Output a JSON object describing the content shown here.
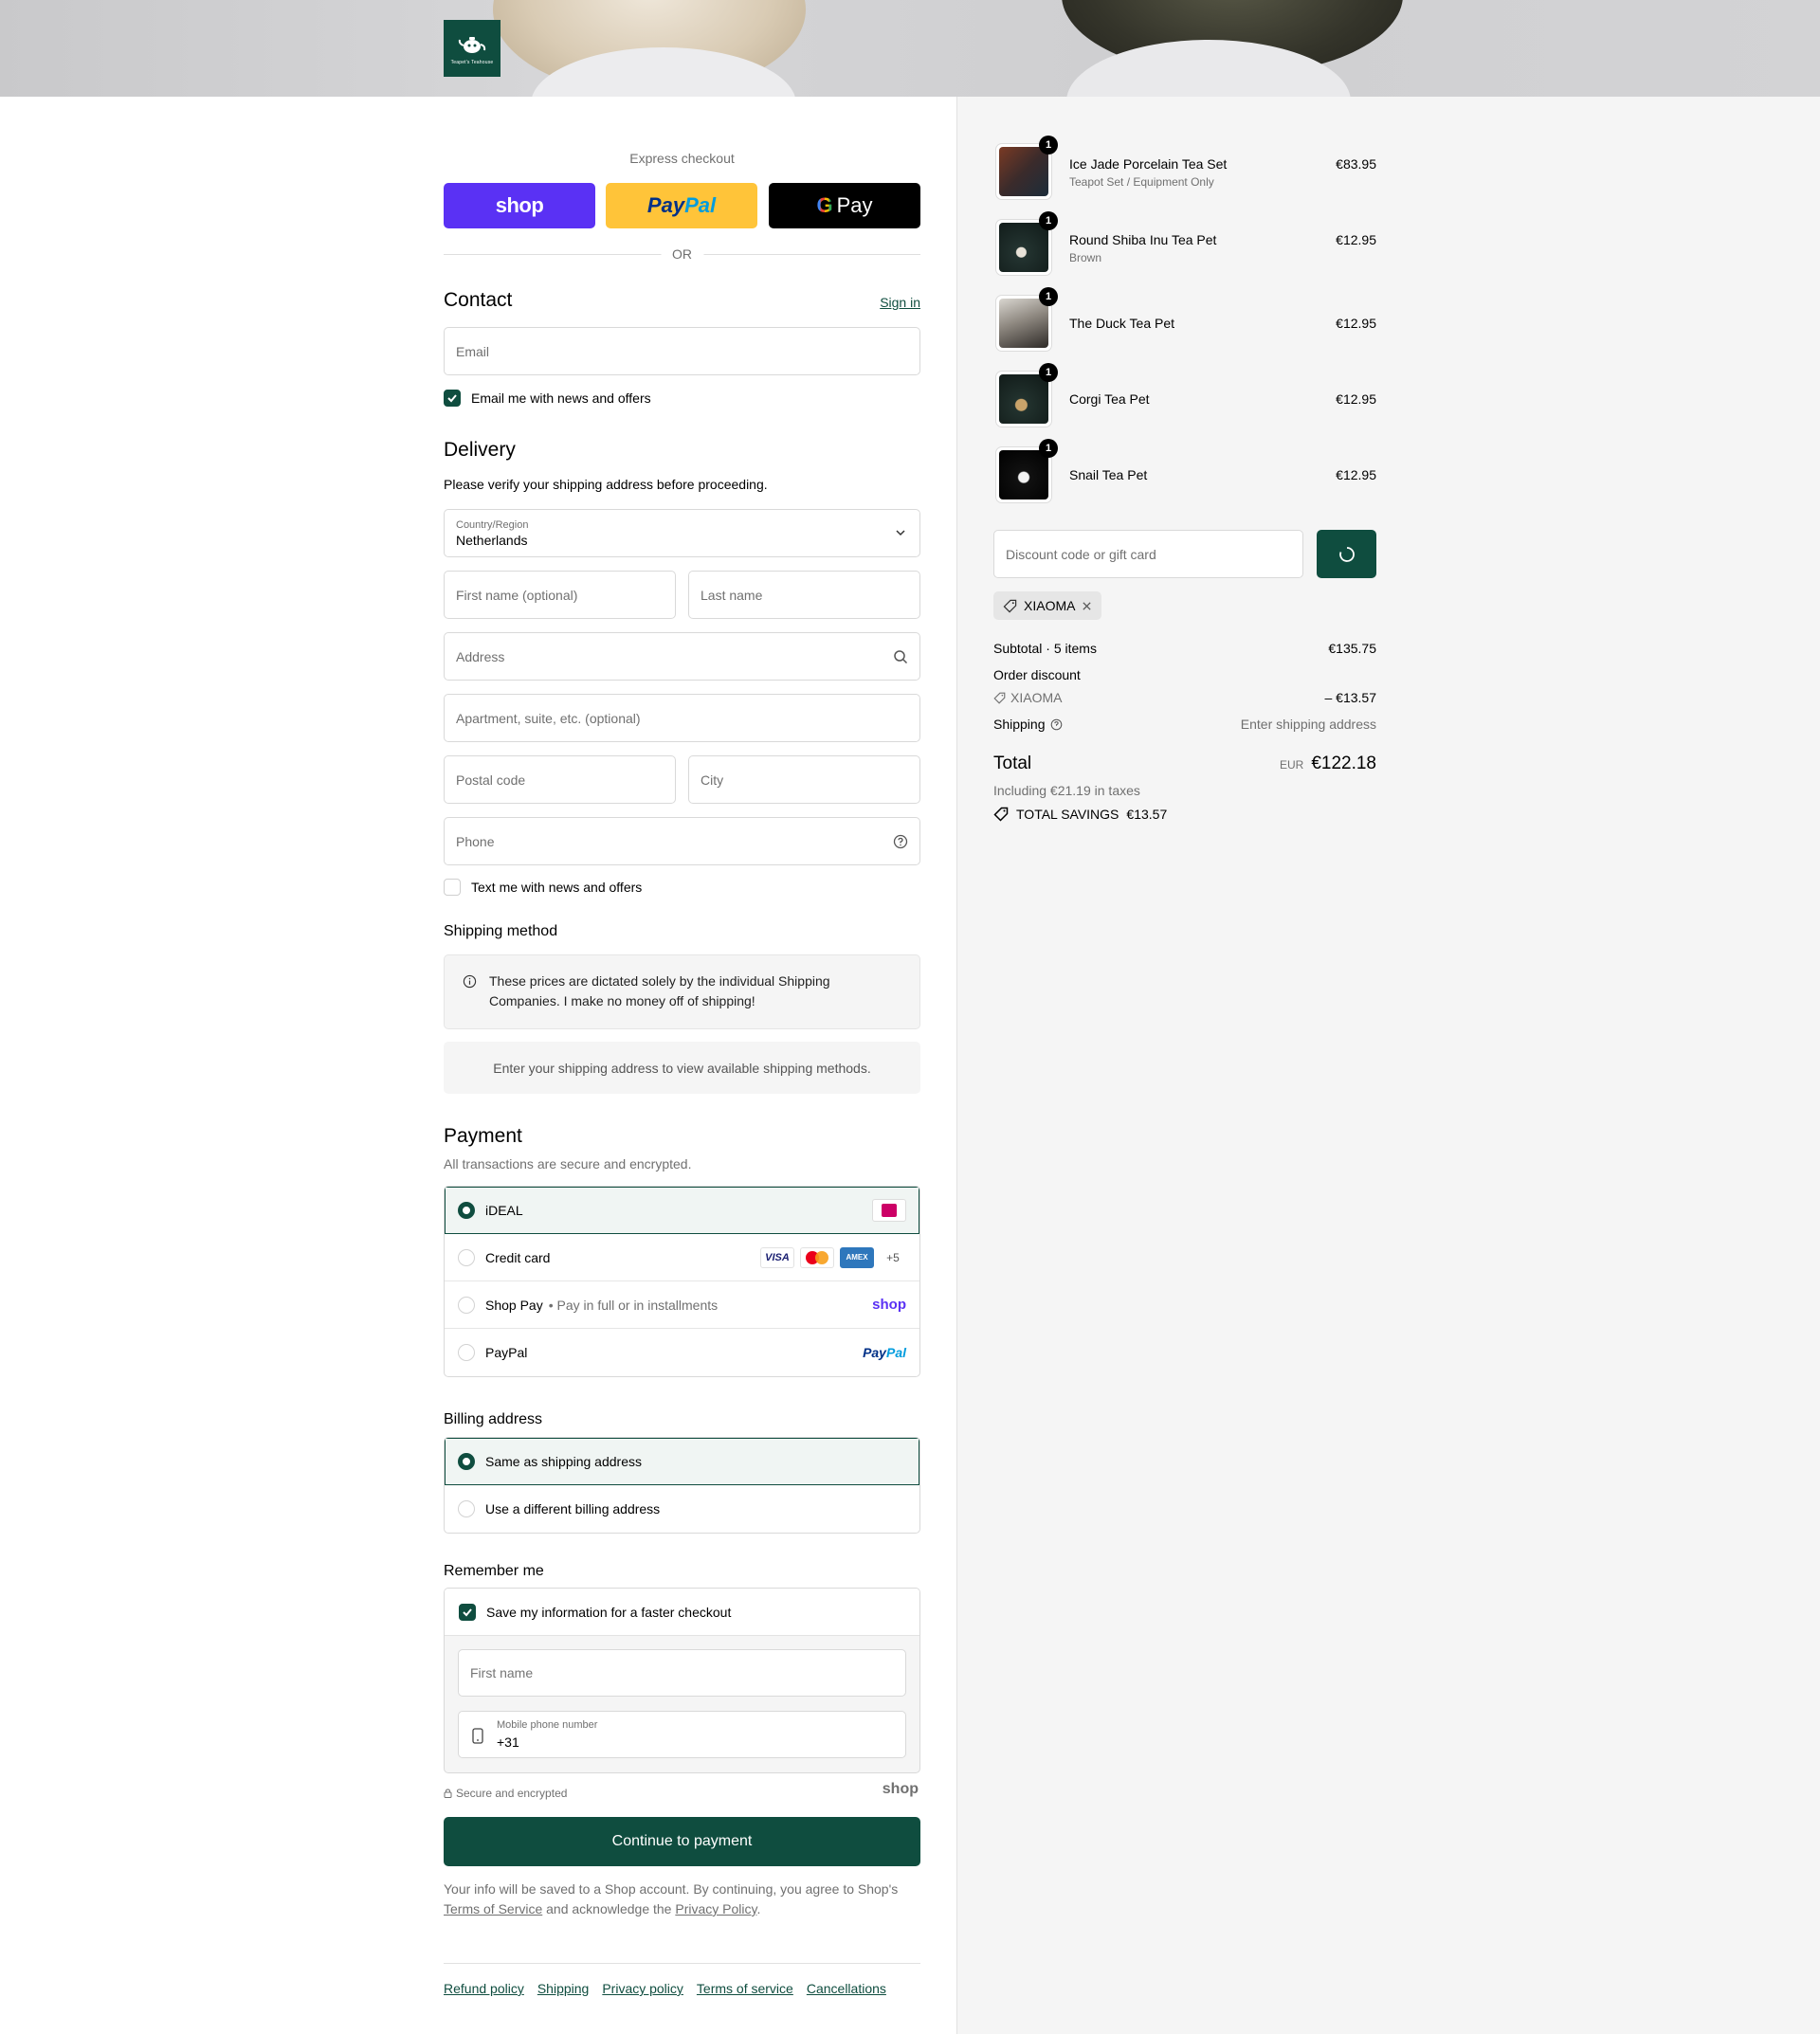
{
  "header": {
    "logo_text": "Teapet's Teahouse"
  },
  "express": {
    "title": "Express checkout",
    "shop_label": "shop",
    "paypal_part1": "Pay",
    "paypal_part2": "Pal",
    "gpay_g": "G",
    "gpay_label": "Pay",
    "or_label": "OR"
  },
  "contact": {
    "title": "Contact",
    "sign_in": "Sign in",
    "email_placeholder": "Email",
    "newsletter_label": "Email me with news and offers",
    "newsletter_checked": true
  },
  "delivery": {
    "title": "Delivery",
    "notice": "Please verify your shipping address before proceeding.",
    "country_label": "Country/Region",
    "country_value": "Netherlands",
    "first_name_placeholder": "First name (optional)",
    "last_name_placeholder": "Last name",
    "address_placeholder": "Address",
    "apartment_placeholder": "Apartment, suite, etc. (optional)",
    "postal_placeholder": "Postal code",
    "city_placeholder": "City",
    "phone_placeholder": "Phone",
    "sms_label": "Text me with news and offers",
    "sms_checked": false
  },
  "shipping_method": {
    "title": "Shipping method",
    "info": "These prices are dictated solely by the individual Shipping Companies. I make no money off of shipping!",
    "empty": "Enter your shipping address to view available shipping methods."
  },
  "payment": {
    "title": "Payment",
    "subtitle": "All transactions are secure and encrypted.",
    "options": [
      {
        "label": "iDEAL",
        "selected": true
      },
      {
        "label": "Credit card",
        "selected": false
      },
      {
        "label": "Shop Pay",
        "sub": "Pay in full or in installments",
        "selected": false
      },
      {
        "label": "PayPal",
        "selected": false
      }
    ],
    "visa": "VISA",
    "amex": "AMEX",
    "more_cards": "+5",
    "shop_logo": "shop",
    "paypal_a": "Pay",
    "paypal_b": "Pal"
  },
  "billing": {
    "title": "Billing address",
    "options": [
      {
        "label": "Same as shipping address",
        "selected": true
      },
      {
        "label": "Use a different billing address",
        "selected": false
      }
    ]
  },
  "remember": {
    "title": "Remember me",
    "save_label": "Save my information for a faster checkout",
    "save_checked": true,
    "first_name_placeholder": "First name",
    "phone_label": "Mobile phone number",
    "phone_value": "+31",
    "secure_label": "Secure and encrypted",
    "shop_logo": "shop"
  },
  "cta": {
    "label": "Continue to payment"
  },
  "legal": {
    "prefix": "Your info will be saved to a Shop account. By continuing, you agree to Shop's",
    "terms": "Terms of Service",
    "middle": "and acknowledge the",
    "privacy": "Privacy Policy",
    "suffix": "."
  },
  "footer": {
    "links": [
      "Refund policy",
      "Shipping",
      "Privacy policy",
      "Terms of service",
      "Cancellations"
    ]
  },
  "summary": {
    "items": [
      {
        "name": "Ice Jade Porcelain Tea Set",
        "variant": "Teapot Set / Equipment Only",
        "price": "€83.95",
        "qty": "1"
      },
      {
        "name": "Round Shiba Inu Tea Pet",
        "variant": "Brown",
        "price": "€12.95",
        "qty": "1"
      },
      {
        "name": "The Duck Tea Pet",
        "variant": "",
        "price": "€12.95",
        "qty": "1"
      },
      {
        "name": "Corgi Tea Pet",
        "variant": "",
        "price": "€12.95",
        "qty": "1"
      },
      {
        "name": "Snail Tea Pet",
        "variant": "",
        "price": "€12.95",
        "qty": "1"
      }
    ],
    "discount_placeholder": "Discount code or gift card",
    "applied_code": "XIAOMA",
    "subtotal_label": "Subtotal · 5 items",
    "subtotal_value": "€135.75",
    "order_discount_label": "Order discount",
    "discount_code": "XIAOMA",
    "discount_value": "– €13.57",
    "shipping_label": "Shipping",
    "shipping_value": "Enter shipping address",
    "total_label": "Total",
    "currency": "EUR",
    "total_value": "€122.18",
    "taxes": "Including €21.19 in taxes",
    "savings_label": "TOTAL SAVINGS",
    "savings_value": "€13.57"
  },
  "colors": {
    "brand": "#0f4d3f",
    "shop": "#5a31f4",
    "paypal_bg": "#ffc439"
  }
}
